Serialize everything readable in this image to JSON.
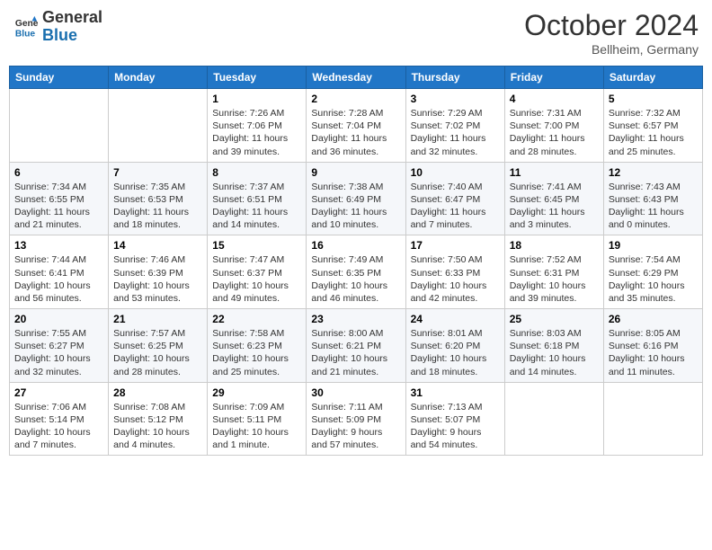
{
  "header": {
    "logo_line1": "General",
    "logo_line2": "Blue",
    "month": "October 2024",
    "location": "Bellheim, Germany"
  },
  "days_of_week": [
    "Sunday",
    "Monday",
    "Tuesday",
    "Wednesday",
    "Thursday",
    "Friday",
    "Saturday"
  ],
  "weeks": [
    [
      {
        "num": "",
        "info": ""
      },
      {
        "num": "",
        "info": ""
      },
      {
        "num": "1",
        "info": "Sunrise: 7:26 AM\nSunset: 7:06 PM\nDaylight: 11 hours and 39 minutes."
      },
      {
        "num": "2",
        "info": "Sunrise: 7:28 AM\nSunset: 7:04 PM\nDaylight: 11 hours and 36 minutes."
      },
      {
        "num": "3",
        "info": "Sunrise: 7:29 AM\nSunset: 7:02 PM\nDaylight: 11 hours and 32 minutes."
      },
      {
        "num": "4",
        "info": "Sunrise: 7:31 AM\nSunset: 7:00 PM\nDaylight: 11 hours and 28 minutes."
      },
      {
        "num": "5",
        "info": "Sunrise: 7:32 AM\nSunset: 6:57 PM\nDaylight: 11 hours and 25 minutes."
      }
    ],
    [
      {
        "num": "6",
        "info": "Sunrise: 7:34 AM\nSunset: 6:55 PM\nDaylight: 11 hours and 21 minutes."
      },
      {
        "num": "7",
        "info": "Sunrise: 7:35 AM\nSunset: 6:53 PM\nDaylight: 11 hours and 18 minutes."
      },
      {
        "num": "8",
        "info": "Sunrise: 7:37 AM\nSunset: 6:51 PM\nDaylight: 11 hours and 14 minutes."
      },
      {
        "num": "9",
        "info": "Sunrise: 7:38 AM\nSunset: 6:49 PM\nDaylight: 11 hours and 10 minutes."
      },
      {
        "num": "10",
        "info": "Sunrise: 7:40 AM\nSunset: 6:47 PM\nDaylight: 11 hours and 7 minutes."
      },
      {
        "num": "11",
        "info": "Sunrise: 7:41 AM\nSunset: 6:45 PM\nDaylight: 11 hours and 3 minutes."
      },
      {
        "num": "12",
        "info": "Sunrise: 7:43 AM\nSunset: 6:43 PM\nDaylight: 11 hours and 0 minutes."
      }
    ],
    [
      {
        "num": "13",
        "info": "Sunrise: 7:44 AM\nSunset: 6:41 PM\nDaylight: 10 hours and 56 minutes."
      },
      {
        "num": "14",
        "info": "Sunrise: 7:46 AM\nSunset: 6:39 PM\nDaylight: 10 hours and 53 minutes."
      },
      {
        "num": "15",
        "info": "Sunrise: 7:47 AM\nSunset: 6:37 PM\nDaylight: 10 hours and 49 minutes."
      },
      {
        "num": "16",
        "info": "Sunrise: 7:49 AM\nSunset: 6:35 PM\nDaylight: 10 hours and 46 minutes."
      },
      {
        "num": "17",
        "info": "Sunrise: 7:50 AM\nSunset: 6:33 PM\nDaylight: 10 hours and 42 minutes."
      },
      {
        "num": "18",
        "info": "Sunrise: 7:52 AM\nSunset: 6:31 PM\nDaylight: 10 hours and 39 minutes."
      },
      {
        "num": "19",
        "info": "Sunrise: 7:54 AM\nSunset: 6:29 PM\nDaylight: 10 hours and 35 minutes."
      }
    ],
    [
      {
        "num": "20",
        "info": "Sunrise: 7:55 AM\nSunset: 6:27 PM\nDaylight: 10 hours and 32 minutes."
      },
      {
        "num": "21",
        "info": "Sunrise: 7:57 AM\nSunset: 6:25 PM\nDaylight: 10 hours and 28 minutes."
      },
      {
        "num": "22",
        "info": "Sunrise: 7:58 AM\nSunset: 6:23 PM\nDaylight: 10 hours and 25 minutes."
      },
      {
        "num": "23",
        "info": "Sunrise: 8:00 AM\nSunset: 6:21 PM\nDaylight: 10 hours and 21 minutes."
      },
      {
        "num": "24",
        "info": "Sunrise: 8:01 AM\nSunset: 6:20 PM\nDaylight: 10 hours and 18 minutes."
      },
      {
        "num": "25",
        "info": "Sunrise: 8:03 AM\nSunset: 6:18 PM\nDaylight: 10 hours and 14 minutes."
      },
      {
        "num": "26",
        "info": "Sunrise: 8:05 AM\nSunset: 6:16 PM\nDaylight: 10 hours and 11 minutes."
      }
    ],
    [
      {
        "num": "27",
        "info": "Sunrise: 7:06 AM\nSunset: 5:14 PM\nDaylight: 10 hours and 7 minutes."
      },
      {
        "num": "28",
        "info": "Sunrise: 7:08 AM\nSunset: 5:12 PM\nDaylight: 10 hours and 4 minutes."
      },
      {
        "num": "29",
        "info": "Sunrise: 7:09 AM\nSunset: 5:11 PM\nDaylight: 10 hours and 1 minute."
      },
      {
        "num": "30",
        "info": "Sunrise: 7:11 AM\nSunset: 5:09 PM\nDaylight: 9 hours and 57 minutes."
      },
      {
        "num": "31",
        "info": "Sunrise: 7:13 AM\nSunset: 5:07 PM\nDaylight: 9 hours and 54 minutes."
      },
      {
        "num": "",
        "info": ""
      },
      {
        "num": "",
        "info": ""
      }
    ]
  ]
}
